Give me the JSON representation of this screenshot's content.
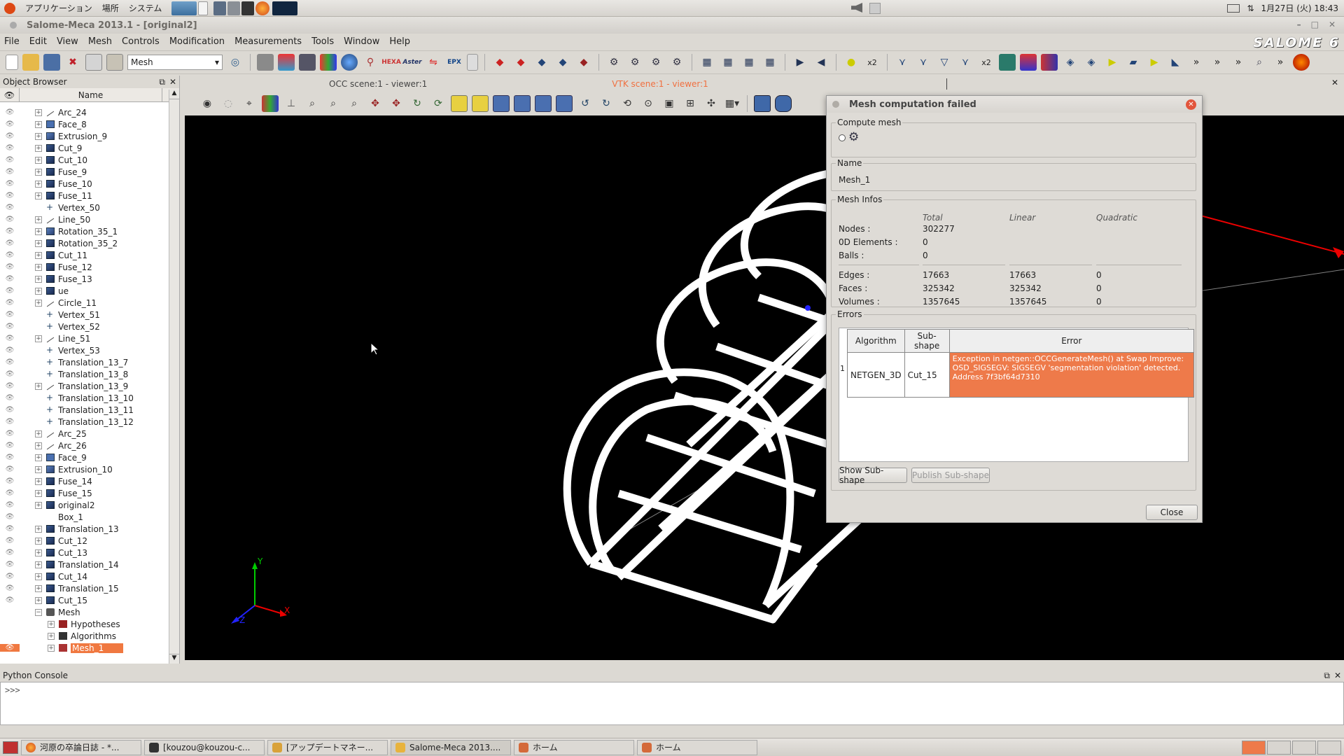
{
  "system_panel": {
    "menus": [
      "アプリケーション",
      "場所",
      "システム"
    ],
    "clock": "1月27日 (火) 18:43"
  },
  "window": {
    "title": "Salome-Meca 2013.1 - [original2]",
    "logo": "SALOME 6"
  },
  "menubar": [
    "File",
    "Edit",
    "View",
    "Mesh",
    "Controls",
    "Modification",
    "Measurements",
    "Tools",
    "Window",
    "Help"
  ],
  "toolbar": {
    "module_combo": "Mesh",
    "text_buttons": {
      "hexa": "HEXA",
      "aster": "Aster",
      "epx": "EPX",
      "x2a": "x2",
      "x2b": "x2"
    }
  },
  "object_browser": {
    "title": "Object Browser",
    "column_name": "Name",
    "items": [
      {
        "label": "Arc_24",
        "icon": "arc"
      },
      {
        "label": "Face_8",
        "icon": "face"
      },
      {
        "label": "Extrusion_9",
        "icon": "solid"
      },
      {
        "label": "Cut_9",
        "icon": "compound"
      },
      {
        "label": "Cut_10",
        "icon": "compound"
      },
      {
        "label": "Fuse_9",
        "icon": "compound"
      },
      {
        "label": "Fuse_10",
        "icon": "compound"
      },
      {
        "label": "Fuse_11",
        "icon": "compound"
      },
      {
        "label": "Vertex_50",
        "icon": "vertex"
      },
      {
        "label": "Line_50",
        "icon": "arc"
      },
      {
        "label": "Rotation_35_1",
        "icon": "solid"
      },
      {
        "label": "Rotation_35_2",
        "icon": "compound"
      },
      {
        "label": "Cut_11",
        "icon": "compound"
      },
      {
        "label": "Fuse_12",
        "icon": "compound"
      },
      {
        "label": "Fuse_13",
        "icon": "compound"
      },
      {
        "label": "ue",
        "icon": "compound"
      },
      {
        "label": "Circle_11",
        "icon": "arc"
      },
      {
        "label": "Vertex_51",
        "icon": "vertex"
      },
      {
        "label": "Vertex_52",
        "icon": "vertex"
      },
      {
        "label": "Line_51",
        "icon": "arc"
      },
      {
        "label": "Vertex_53",
        "icon": "vertex"
      },
      {
        "label": "Translation_13_7",
        "icon": "vertex"
      },
      {
        "label": "Translation_13_8",
        "icon": "vertex"
      },
      {
        "label": "Translation_13_9",
        "icon": "arc"
      },
      {
        "label": "Translation_13_10",
        "icon": "vertex"
      },
      {
        "label": "Translation_13_11",
        "icon": "vertex"
      },
      {
        "label": "Translation_13_12",
        "icon": "vertex"
      },
      {
        "label": "Arc_25",
        "icon": "arc"
      },
      {
        "label": "Arc_26",
        "icon": "arc"
      },
      {
        "label": "Face_9",
        "icon": "face"
      },
      {
        "label": "Extrusion_10",
        "icon": "solid"
      },
      {
        "label": "Fuse_14",
        "icon": "compound"
      },
      {
        "label": "Fuse_15",
        "icon": "compound"
      },
      {
        "label": "original2",
        "icon": "compound"
      },
      {
        "label": "Box_1",
        "icon": "none"
      },
      {
        "label": "Translation_13",
        "icon": "compound"
      },
      {
        "label": "Cut_12",
        "icon": "compound"
      },
      {
        "label": "Cut_13",
        "icon": "compound"
      },
      {
        "label": "Translation_14",
        "icon": "compound"
      },
      {
        "label": "Cut_14",
        "icon": "compound"
      },
      {
        "label": "Translation_15",
        "icon": "compound"
      },
      {
        "label": "Cut_15",
        "icon": "compound"
      }
    ],
    "mesh_root": "Mesh",
    "mesh_children": [
      "Hypotheses",
      "Algorithms",
      "Mesh_1"
    ]
  },
  "viewer": {
    "tab_occ": "OCC scene:1 - viewer:1",
    "tab_vtk": "VTK scene:1 - viewer:1",
    "axis_x": "X",
    "axis_y": "Y",
    "axis_z": "Z"
  },
  "dialog": {
    "title": "Mesh computation failed",
    "compute_group": "Compute mesh",
    "name_group": "Name",
    "mesh_name": "Mesh_1",
    "infos_group": "Mesh Infos",
    "col_total": "Total",
    "col_linear": "Linear",
    "col_quadratic": "Quadratic",
    "rows_top": [
      {
        "label": "Nodes :",
        "total": "302277"
      },
      {
        "label": "0D Elements :",
        "total": "0"
      },
      {
        "label": "Balls :",
        "total": "0"
      }
    ],
    "rows_bottom": [
      {
        "label": "Edges :",
        "total": "17663",
        "linear": "17663",
        "quadratic": "0"
      },
      {
        "label": "Faces :",
        "total": "325342",
        "linear": "325342",
        "quadratic": "0"
      },
      {
        "label": "Volumes :",
        "total": "1357645",
        "linear": "1357645",
        "quadratic": "0"
      }
    ],
    "errors_group": "Errors",
    "err_col_algorithm": "Algorithm",
    "err_col_subshape": "Sub-shape",
    "err_col_error": "Error",
    "error_row": {
      "index": "1",
      "algorithm": "NETGEN_3D",
      "subshape": "Cut_15",
      "error": "Exception in  netgen::OCCGenerateMesh() at Swap Improve: OSD_SIGSEGV: SIGSEGV 'segmentation violation' detected. Address 7f3bf64d7310"
    },
    "show_subshape": "Show Sub-shape",
    "publish_subshape": "Publish Sub-shape",
    "close": "Close"
  },
  "python_console": {
    "title": "Python Console",
    "prompt": ">>>"
  },
  "taskbar": [
    "河原の卒論日誌 - *...",
    "[kouzou@kouzou-c...",
    "[アップデートマネー...",
    "Salome-Meca 2013....",
    "ホーム",
    "ホーム"
  ],
  "colors": {
    "selection": "#f07840",
    "error_bg": "#ee7a4a",
    "viewer_bg": "#000000"
  }
}
